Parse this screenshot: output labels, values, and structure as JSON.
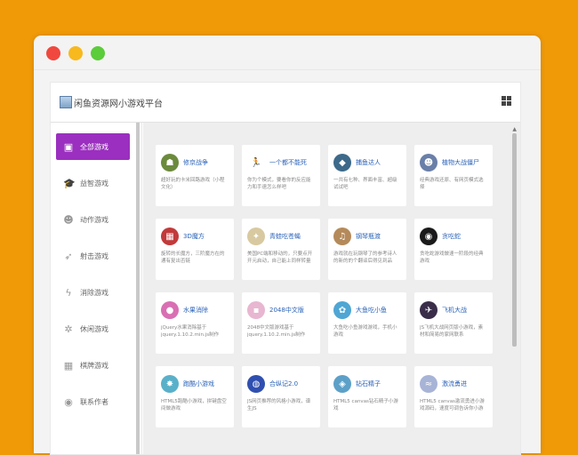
{
  "app": {
    "title": "闲鱼资源网小游戏平台"
  },
  "colors": {
    "background": "#f09a08",
    "active_nav": "#9b2fbf",
    "card_title": "#2a62b8"
  },
  "sidebar": {
    "items": [
      {
        "label": "全部游戏",
        "icon": "twitch-icon",
        "glyph": "▣",
        "active": true
      },
      {
        "label": "益智游戏",
        "icon": "graduation-cap-icon",
        "glyph": "🎓",
        "active": false
      },
      {
        "label": "动作游戏",
        "icon": "reddit-alien-icon",
        "glyph": "☻",
        "active": false
      },
      {
        "label": "射击游戏",
        "icon": "rocket-icon",
        "glyph": "➶",
        "active": false
      },
      {
        "label": "消除游戏",
        "icon": "bolt-icon",
        "glyph": "ϟ",
        "active": false
      },
      {
        "label": "休闲游戏",
        "icon": "glass-icon",
        "glyph": "✲",
        "active": false
      },
      {
        "label": "棋牌游戏",
        "icon": "chess-board-icon",
        "glyph": "▦",
        "active": false
      },
      {
        "label": "联系作者",
        "icon": "user-icon",
        "glyph": "◉",
        "active": false
      }
    ]
  },
  "games": [
    {
      "name": "修京战争",
      "desc": "超好玩的卡米回路游戏（小程文化）",
      "icon": "soldier-icon",
      "color": "#6c8a3d",
      "glyph": "☗"
    },
    {
      "name": "一个都不能死",
      "desc": "你为个模式，要看你的反应能力和手速怎么样吧",
      "icon": "stickman-icon",
      "color": "#ffffff",
      "glyph": "🏃"
    },
    {
      "name": "捕鱼达人",
      "desc": "一共有七种、界面丰富、超级试试吧",
      "icon": "fishing-icon",
      "color": "#3d6a8a",
      "glyph": "◆"
    },
    {
      "name": "植物大战僵尸",
      "desc": "经典游戏还原、有网页模式选择",
      "icon": "zombie-icon",
      "color": "#6a7fa8",
      "glyph": "☻"
    },
    {
      "name": "3D魔方",
      "desc": "旋转的长魔方，三阶魔方在的通有复出否链",
      "icon": "rubik-cube-icon",
      "color": "#c23a3a",
      "glyph": "▦"
    },
    {
      "name": "青蛙吃苍蝇",
      "desc": "美国PC端和移动的，只要点开开元启动，自己能上同样转量",
      "icon": "frog-icon",
      "color": "#d8c9a0",
      "glyph": "✦"
    },
    {
      "name": "钢琴瓶渡",
      "desc": "游戏就在玩钢琴了的参考诗人的新的的个翻译后得见到品",
      "icon": "piano-icon",
      "color": "#b58a5a",
      "glyph": "♫"
    },
    {
      "name": "贪吃蛇",
      "desc": "贪吃蛇游戏做速一阶段的经典游戏",
      "icon": "snake-icon",
      "color": "#1a1a1a",
      "glyph": "◉"
    },
    {
      "name": "水果消除",
      "desc": "jQuery水果消除基于jquery.1.10.2.min.js制作（小程alaidi）",
      "icon": "fruit-icon",
      "color": "#d96fb3",
      "glyph": "●"
    },
    {
      "name": "2048中文版",
      "desc": "2048中文版游戏基于jquery.1.10.2.min.js制作",
      "icon": "2048-icon",
      "color": "#e8b6d0",
      "glyph": "▪"
    },
    {
      "name": "大鱼吃小鱼",
      "desc": "大鱼吃小鱼游戏游戏，手机小游戏",
      "icon": "big-fish-icon",
      "color": "#4fa6d4",
      "glyph": "✿"
    },
    {
      "name": "飞机大战",
      "desc": "JS飞机大战网页版小游戏，素材和简易的家网联系",
      "icon": "airplane-icon",
      "color": "#3a2d4a",
      "glyph": "✈"
    },
    {
      "name": "跑酷小游戏",
      "desc": "HTML5跑酷小游戏，拼键盘空间做游戏",
      "icon": "parkour-icon",
      "color": "#5ab0c9",
      "glyph": "✸"
    },
    {
      "name": "合纵记2.0",
      "desc": "JS网页推荐的风格小游戏，谱生JS",
      "icon": "lianliankan-icon",
      "color": "#2f4fb0",
      "glyph": "◍"
    },
    {
      "name": "钻石精子",
      "desc": "HTML5 canvas钻石精子小游戏",
      "icon": "diamond-icon",
      "color": "#5ca0c8",
      "glyph": "◈"
    },
    {
      "name": "激流勇进",
      "desc": "HTML5 canvas激流勇进小游戏源码，速度可调告诉你小游戏",
      "icon": "rafting-icon",
      "color": "#a8b4d6",
      "glyph": "≈"
    }
  ]
}
